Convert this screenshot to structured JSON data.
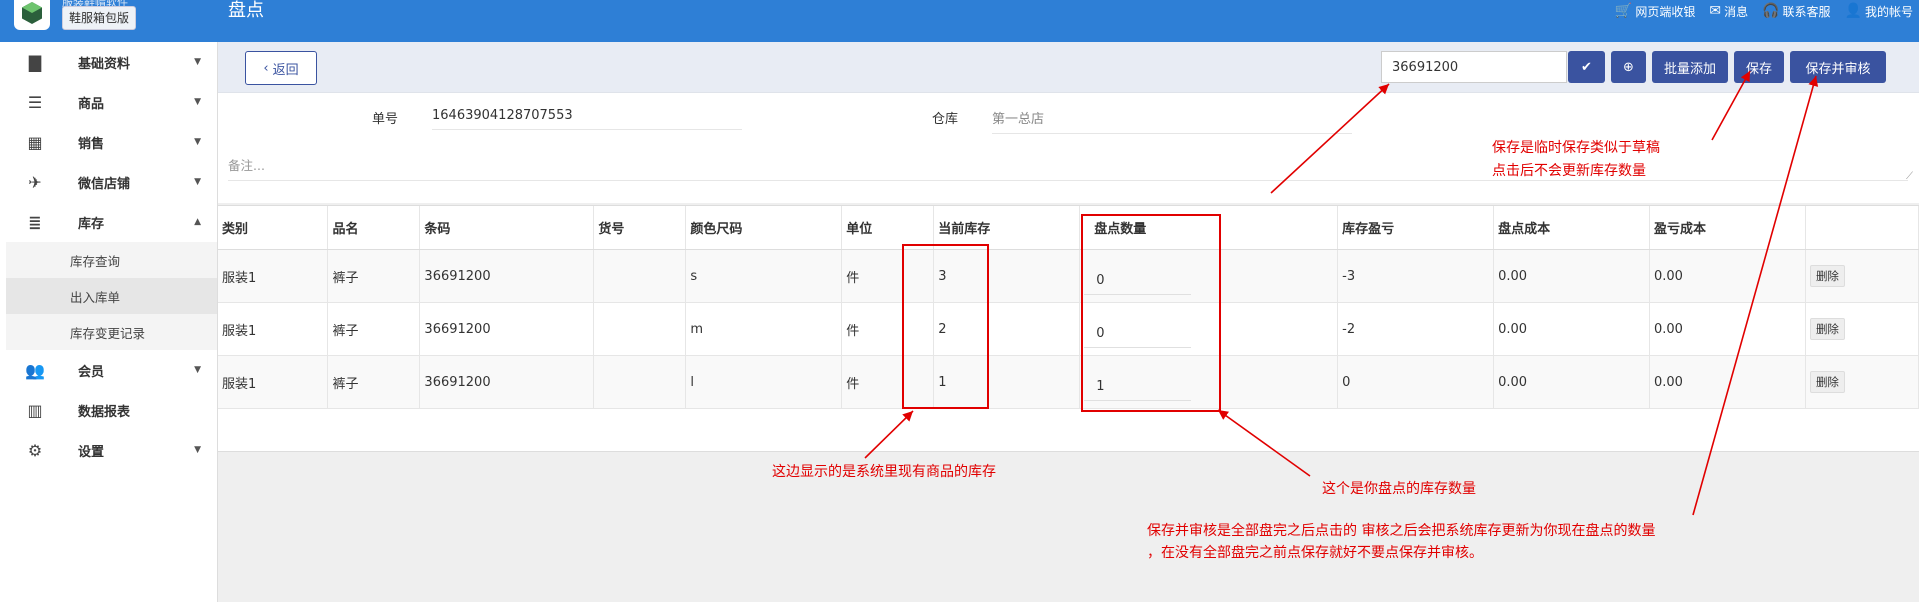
{
  "app": {
    "brand_name_cut": "服装鞋帽软件",
    "edition": "鞋服箱包版",
    "page_title": "盘点"
  },
  "topnav": [
    {
      "icon": "cart-icon",
      "label": "网页端收银"
    },
    {
      "icon": "envelope-icon",
      "label": "消息"
    },
    {
      "icon": "headset-icon",
      "label": "联系客服"
    },
    {
      "icon": "user-icon",
      "label": "我的帐号"
    }
  ],
  "sidebar": {
    "items": [
      {
        "icon": "document-icon",
        "label": "基础资料"
      },
      {
        "icon": "list-icon",
        "label": "商品"
      },
      {
        "icon": "table-icon",
        "label": "销售"
      },
      {
        "icon": "paper-plane-icon",
        "label": "微信店铺"
      },
      {
        "icon": "database-icon",
        "label": "库存"
      },
      {
        "icon": "users-icon",
        "label": "会员"
      },
      {
        "icon": "bar-chart-icon",
        "label": "数据报表"
      },
      {
        "icon": "gear-icon",
        "label": "设置"
      }
    ],
    "stock_sub": [
      "库存查询",
      "出入库单",
      "库存变更记录"
    ]
  },
  "toolbar": {
    "back_label": "返回",
    "scan_value": "36691200",
    "confirm_icon": "check-icon",
    "search_icon": "zoom-in-icon",
    "batch_add_label": "批量添加",
    "save_label": "保存",
    "save_audit_label": "保存并审核"
  },
  "form": {
    "order_no_label": "单号",
    "order_no_value": "16463904128707553",
    "warehouse_label": "仓库",
    "warehouse_value": "第一总店",
    "remark_placeholder": "备注..."
  },
  "table": {
    "headers": [
      "类别",
      "品名",
      "条码",
      "货号",
      "颜色尺码",
      "单位",
      "当前库存",
      "盘点数量",
      "库存盈亏",
      "盘点成本",
      "盈亏成本",
      ""
    ],
    "rows": [
      {
        "category": "服装1",
        "name": "裤子",
        "barcode": "36691200",
        "sku": "",
        "color_size": "s",
        "unit": "件",
        "stock": "3",
        "count": "0",
        "diff": "-3",
        "count_cost": "0.00",
        "diff_cost": "0.00",
        "delete": "删除"
      },
      {
        "category": "服装1",
        "name": "裤子",
        "barcode": "36691200",
        "sku": "",
        "color_size": "m",
        "unit": "件",
        "stock": "2",
        "count": "0",
        "diff": "-2",
        "count_cost": "0.00",
        "diff_cost": "0.00",
        "delete": "删除"
      },
      {
        "category": "服装1",
        "name": "裤子",
        "barcode": "36691200",
        "sku": "",
        "color_size": "l",
        "unit": "件",
        "stock": "1",
        "count": "1",
        "diff": "0",
        "count_cost": "0.00",
        "diff_cost": "0.00",
        "delete": "删除"
      }
    ]
  },
  "annotations": {
    "save_note_line1": "保存是临时保存类似于草稿",
    "save_note_line2": "点击后不会更新库存数量",
    "stock_note": "这边显示的是系统里现有商品的库存",
    "count_note": "这个是你盘点的库存数量",
    "audit_note_line1": "保存并审核是全部盘完之后点击的 审核之后会把系统库存更新为你现在盘点的数量",
    "audit_note_line2": "，在没有全部盘完之前点保存就好不要点保存并审核。",
    "color": "#e10000"
  },
  "colors": {
    "topbar": "#2e7fd6",
    "primary_button": "#3a53a0"
  }
}
